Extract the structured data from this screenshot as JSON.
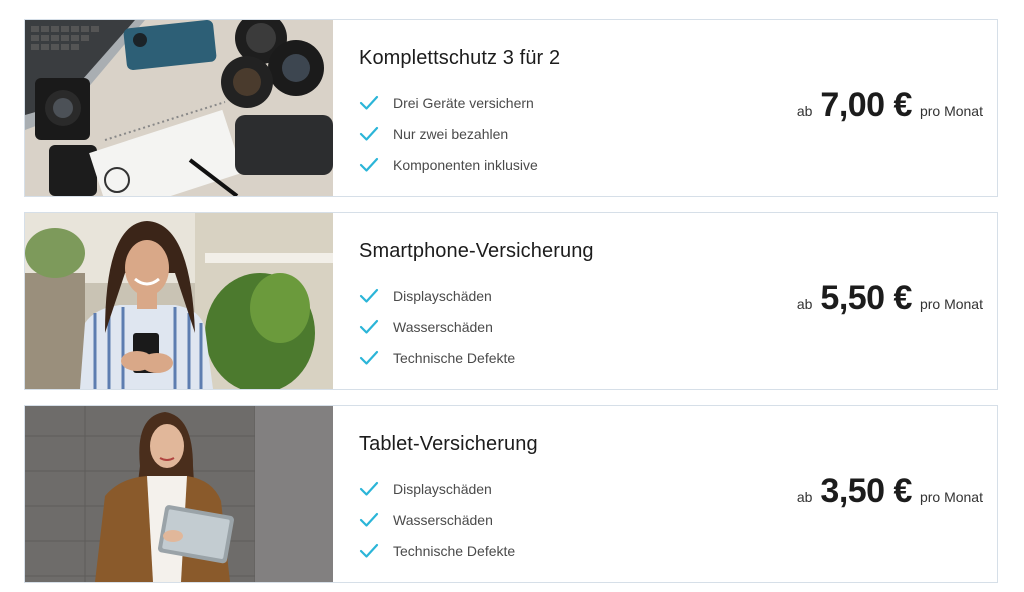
{
  "products": [
    {
      "title": "Komplettschutz 3 für 2",
      "image": "camera-flatlay-photo",
      "features": [
        "Drei Geräte versichern",
        "Nur zwei bezahlen",
        "Komponenten inklusive"
      ],
      "price_prefix": "ab",
      "price": "7,00 €",
      "price_suffix": "pro Monat"
    },
    {
      "title": "Smartphone-Versicherung",
      "image": "woman-smartphone-photo",
      "features": [
        "Displayschäden",
        "Wasserschäden",
        "Technische Defekte"
      ],
      "price_prefix": "ab",
      "price": "5,50 €",
      "price_suffix": "pro Monat"
    },
    {
      "title": "Tablet-Versicherung",
      "image": "woman-tablet-photo",
      "features": [
        "Displayschäden",
        "Wasserschäden",
        "Technische Defekte"
      ],
      "price_prefix": "ab",
      "price": "3,50 €",
      "price_suffix": "pro Monat"
    }
  ],
  "colors": {
    "check": "#2bb5d8",
    "border": "#d6dfe8",
    "text": "#1c1c1c"
  },
  "icons": {
    "feature": "check-icon"
  }
}
